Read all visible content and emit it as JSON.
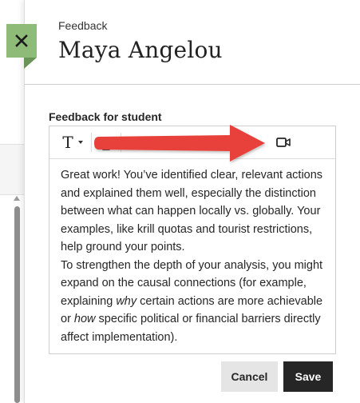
{
  "panel": {
    "kicker": "Feedback",
    "title": "Maya Angelou",
    "close_icon": "close-icon"
  },
  "editor": {
    "label": "Feedback for student",
    "toolbar": {
      "format_glyph": "T",
      "format_icon": "text-format-icon",
      "caret_icon": "chevron-down-icon",
      "video_icon": "video-camera-icon"
    },
    "content": {
      "p1": "Great work! You’ve identified clear, relevant actions and explained them well, especially the distinction between what can happen locally vs. globally. Your examples, like krill quotas and tourist restrictions, help ground your points.",
      "p2_a": "To strengthen the depth of your analysis, you might expand on the causal connections  (for example, explaining ",
      "p2_em1": "why",
      "p2_b": " certain actions are more achievable or ",
      "p2_em2": "how",
      "p2_c": " specific political or financial barriers directly affect implementation)."
    }
  },
  "actions": {
    "cancel_label": "Cancel",
    "save_label": "Save"
  },
  "colors": {
    "close_tab": "#8fbb79",
    "save_bg": "#262626",
    "cancel_bg": "#e5e5e5",
    "annotation_arrow": "#e8413a"
  }
}
